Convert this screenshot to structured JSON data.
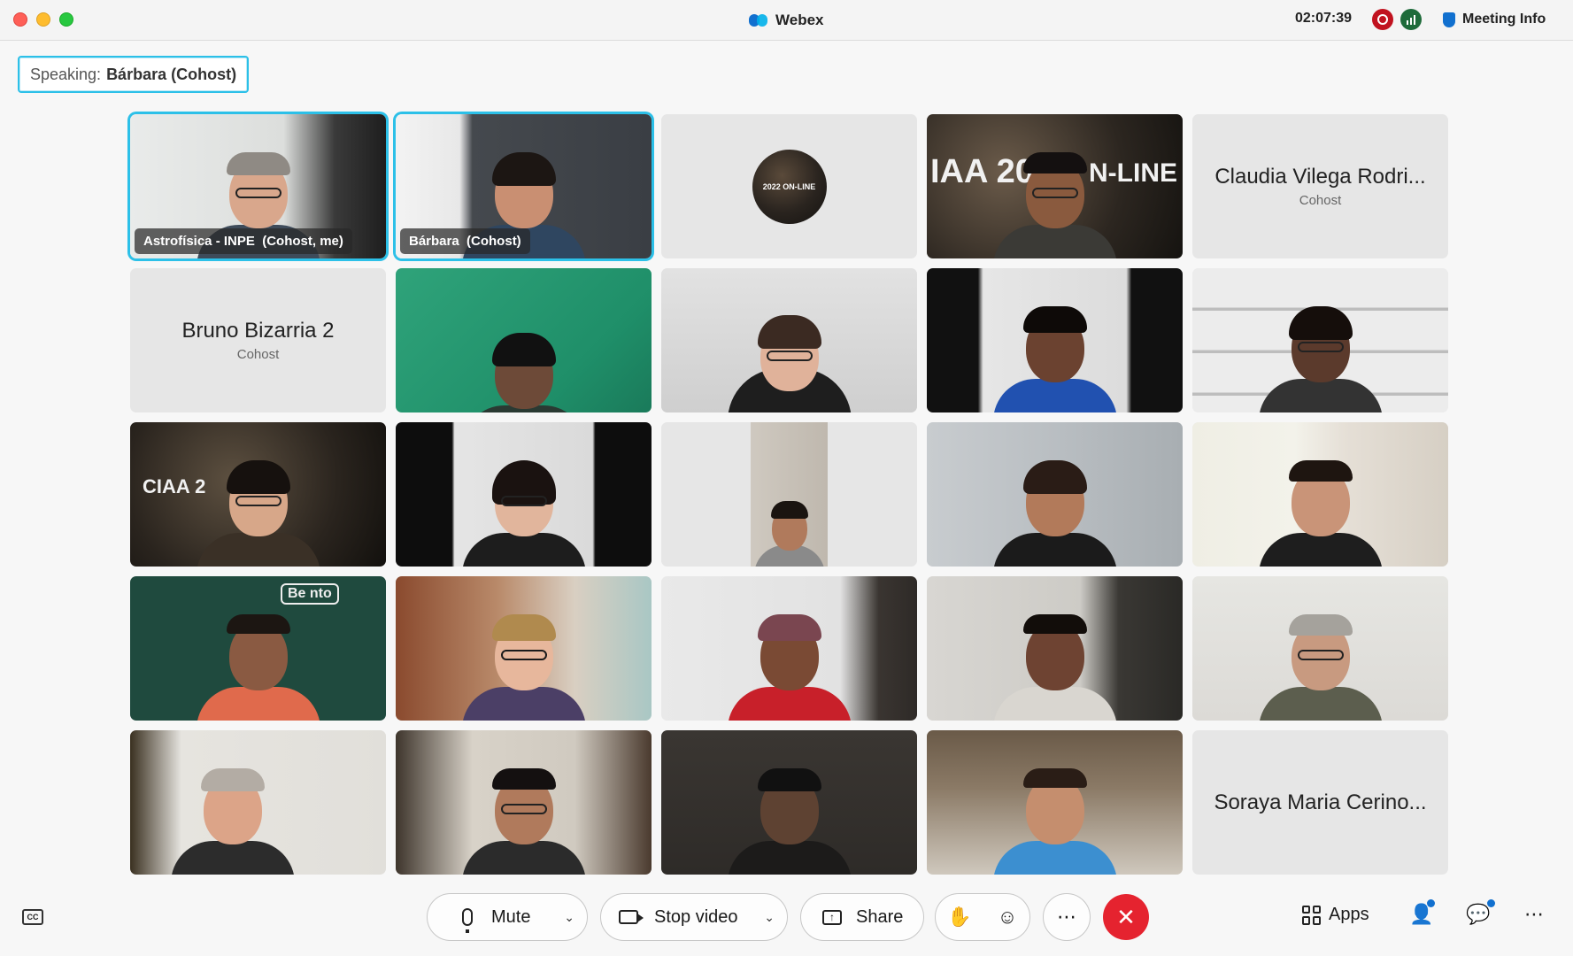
{
  "window": {
    "app_title": "Webex",
    "clock": "02:07:39",
    "meeting_info_label": "Meeting Info"
  },
  "speaking": {
    "label": "Speaking:",
    "name": "Bárbara (Cohost)"
  },
  "tiles": [
    {
      "label": "Astrofísica - INPE  (Cohost, me)",
      "kind": "video",
      "active": true
    },
    {
      "label": "Bárbara  (Cohost)",
      "kind": "video",
      "active": true
    },
    {
      "kind": "logo",
      "logo_text": "2022 ON-LINE"
    },
    {
      "kind": "video",
      "banner_left": "IAA 20",
      "banner_right": "N-LINE"
    },
    {
      "kind": "name",
      "name": "Claudia Vilega Rodri...",
      "role": "Cohost"
    },
    {
      "kind": "name",
      "name": "Bruno Bizarria 2",
      "role": "Cohost"
    },
    {
      "kind": "video"
    },
    {
      "kind": "video"
    },
    {
      "kind": "video"
    },
    {
      "kind": "video"
    },
    {
      "kind": "video",
      "banner_left": "CIAA 2"
    },
    {
      "kind": "video"
    },
    {
      "kind": "video"
    },
    {
      "kind": "video"
    },
    {
      "kind": "video"
    },
    {
      "kind": "video",
      "board_text": "Be nto"
    },
    {
      "kind": "video"
    },
    {
      "kind": "video"
    },
    {
      "kind": "video"
    },
    {
      "kind": "video"
    },
    {
      "kind": "video"
    },
    {
      "kind": "video"
    },
    {
      "kind": "video"
    },
    {
      "kind": "video"
    },
    {
      "kind": "name",
      "name": "Soraya Maria Cerino...",
      "role": ""
    }
  ],
  "controls": {
    "mute_label": "Mute",
    "stop_video_label": "Stop video",
    "share_label": "Share",
    "apps_label": "Apps",
    "cc_label": "CC"
  },
  "colors": {
    "active_border": "#2cc0e8",
    "end_call": "#e5232f",
    "accent": "#1170cf"
  }
}
